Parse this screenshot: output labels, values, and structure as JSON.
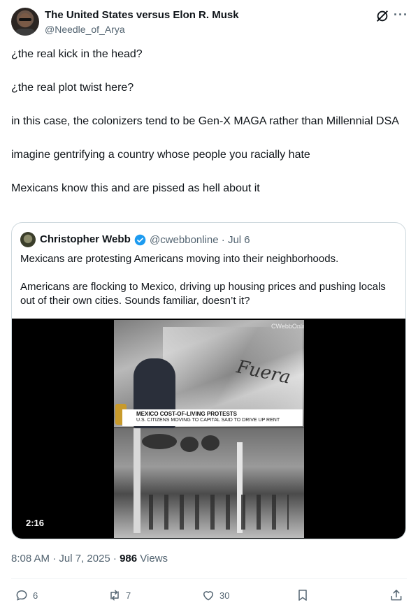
{
  "author": {
    "display_name": "The United States versus Elon R. Musk",
    "handle": "@Needle_of_Arya"
  },
  "header_icons": [
    "grok-icon",
    "more-icon"
  ],
  "more_label": "···",
  "tweet_paragraphs": [
    "¿the real kick in the head?",
    "¿the real plot twist here?",
    "in this case, the colonizers tend to be Gen-X MAGA rather than Millennial DSA",
    "imagine gentrifying a country whose people you racially hate",
    "Mexicans know this and are pissed as hell about it"
  ],
  "quote": {
    "display_name": "Christopher Webb",
    "handle_date": "@cwebbonline · Jul 6",
    "paragraphs": [
      "Mexicans are protesting Americans moving into their neighborhoods.",
      "Americans are flocking to Mexico, driving up housing prices and pushing locals out of their own cities. Sounds familiar, doesn’t it?"
    ],
    "video": {
      "headline": "MEXICO COST-OF-LIVING PROTESTS",
      "subheadline": "U.S. CITIZENS MOVING TO CAPITAL SAID TO DRIVE UP RENT",
      "watermark": "CWebbOnline",
      "graffiti": "Fuera",
      "duration": "2:16"
    }
  },
  "meta": {
    "time_date": "8:08 AM · Jul 7, 2025 · ",
    "views_count": "986",
    "views_label": " Views"
  },
  "actions": {
    "replies": "6",
    "reposts": "7",
    "likes": "30"
  },
  "colors": {
    "text": "#0f1419",
    "secondary": "#536471",
    "verified": "#1d9bf0",
    "border": "#cfd9de"
  }
}
